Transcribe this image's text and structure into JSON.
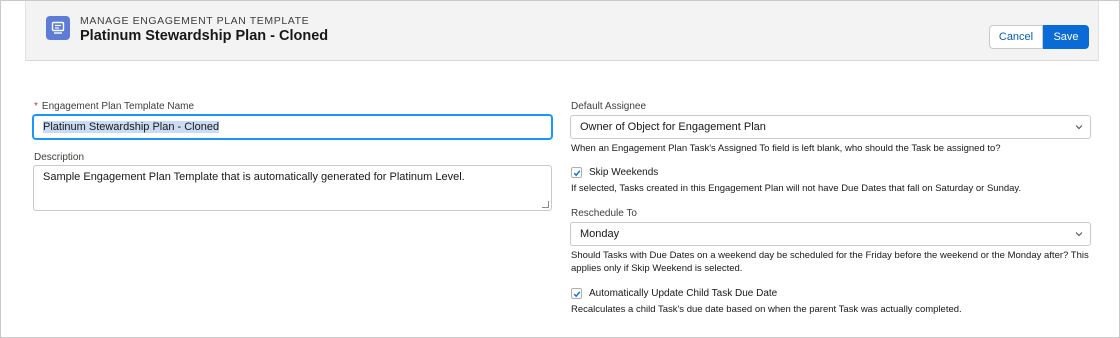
{
  "header": {
    "eyebrow": "MANAGE ENGAGEMENT PLAN TEMPLATE",
    "title": "Platinum Stewardship Plan - Cloned",
    "icon": "template-icon",
    "cancel_label": "Cancel",
    "save_label": "Save"
  },
  "form": {
    "name": {
      "required_marker": "*",
      "label": "Engagement Plan Template Name",
      "value": "Platinum Stewardship Plan - Cloned"
    },
    "description": {
      "label": "Description",
      "value": "Sample Engagement Plan Template that is automatically generated for Platinum Level."
    },
    "default_assignee": {
      "label": "Default Assignee",
      "value": "Owner of Object for Engagement Plan",
      "help": "When an Engagement Plan Task's Assigned To field is left blank, who should the Task be assigned to?"
    },
    "skip_weekends": {
      "label": "Skip Weekends",
      "checked": true,
      "help": "If selected, Tasks created in this Engagement Plan will not have Due Dates that fall on Saturday or Sunday."
    },
    "reschedule_to": {
      "label": "Reschedule To",
      "value": "Monday",
      "help_line1": "Should Tasks with Due Dates on a weekend day be scheduled for the Friday before the weekend or the Monday after? This",
      "help_line2": "applies only if Skip Weekend is selected."
    },
    "auto_update": {
      "label": "Automatically Update Child Task Due Date",
      "checked": true,
      "help": "Recalculates a child Task's due date based on when the parent Task was actually completed."
    }
  },
  "colors": {
    "brand": "#0b6bd6",
    "focus": "#1b96ff",
    "icon_bg": "#5c7cd6",
    "required": "#c23934"
  }
}
